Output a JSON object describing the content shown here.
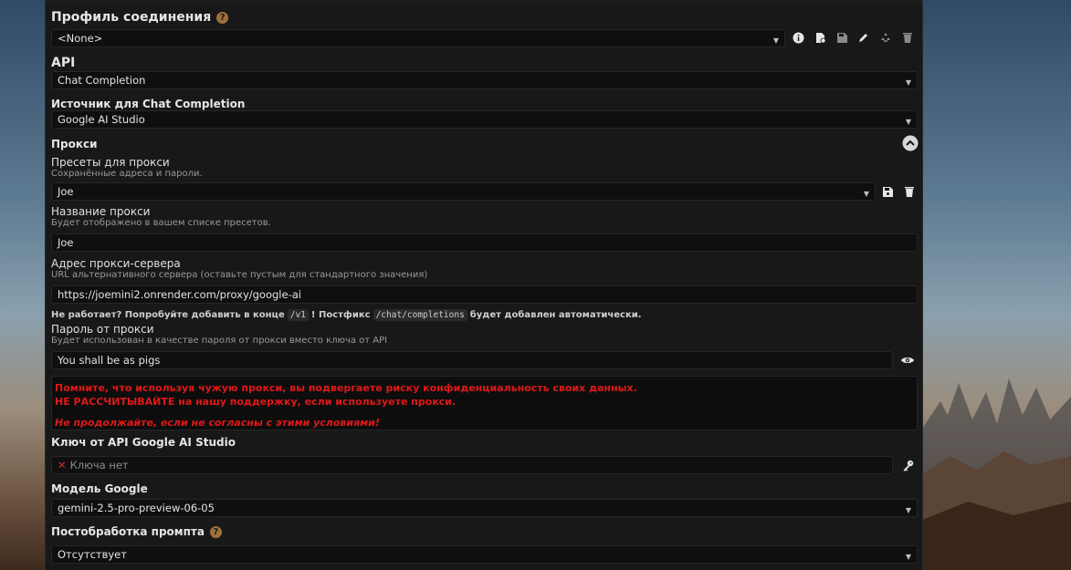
{
  "connection_profile": {
    "title": "Профиль соединения",
    "help": "?",
    "selected": "<None>"
  },
  "api": {
    "title": "API",
    "selected": "Chat Completion"
  },
  "source": {
    "title": "Источник для Chat Completion",
    "selected": "Google AI Studio"
  },
  "proxy": {
    "title": "Прокси",
    "presets_label": "Пресеты для прокси",
    "presets_sub": "Сохранённые адреса и пароли.",
    "preset_selected": "Joe",
    "name_label": "Название прокси",
    "name_sub": "Будет отображено в вашем списке пресетов.",
    "name_value": "Joe",
    "url_label": "Адрес прокси-сервера",
    "url_sub": "URL альтернативного сервера (оставьте пустым для стандартного значения)",
    "url_value": "https://joemini2.onrender.com/proxy/google-ai",
    "hint_part1": "Не работает? Попробуйте добавить в конце",
    "hint_code1": "/v1",
    "hint_part2": "! Постфикс",
    "hint_code2": "/chat/completions",
    "hint_part3": "будет добавлен автоматически.",
    "password_label": "Пароль от прокси",
    "password_sub": "Будет использован в качестве пароля от прокси вместо ключа от API",
    "password_value": "You shall be as pigs",
    "warning_line1": "Помните, что используя чужую прокси, вы подвергаете риску конфиденциальность своих данных.",
    "warning_line2": "НЕ РАССЧИТЫВАЙТЕ на нашу поддержку, если используете прокси.",
    "warning_line3": "Не продолжайте, если не согласны с этими условиями!"
  },
  "api_key": {
    "title": "Ключ от API Google AI Studio",
    "status": "Ключа нет"
  },
  "model": {
    "title": "Модель Google",
    "selected": "gemini-2.5-pro-preview-06-05"
  },
  "postprocess": {
    "title": "Постобработка промпта",
    "help": "?",
    "selected": "Отсутствует"
  },
  "colors": {
    "warning": "#e01818",
    "help_badge": "#a0703a",
    "panel_bg": "#181818",
    "field_bg": "#0f0f0f"
  }
}
